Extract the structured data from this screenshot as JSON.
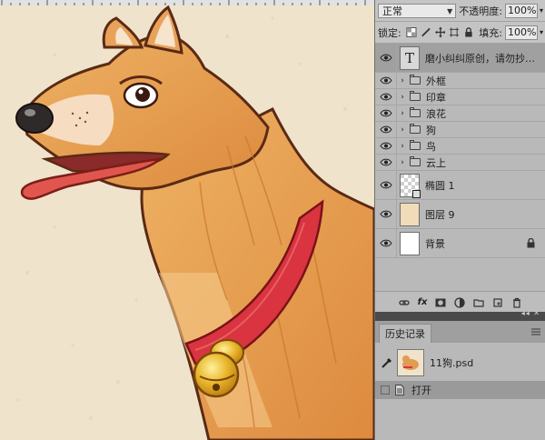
{
  "layers_panel": {
    "blend_mode": "正常",
    "opacity_label": "不透明度:",
    "opacity_value": "100%",
    "lock_label": "锁定:",
    "fill_label": "填充:",
    "fill_value": "100%",
    "layers": [
      {
        "kind": "text",
        "name": "磨小纠纠原创，请勿抄…",
        "selected": true
      },
      {
        "kind": "group",
        "name": "外框"
      },
      {
        "kind": "group",
        "name": "印章"
      },
      {
        "kind": "group",
        "name": "浪花"
      },
      {
        "kind": "group",
        "name": "狗"
      },
      {
        "kind": "group",
        "name": "鸟"
      },
      {
        "kind": "group",
        "name": "云上"
      },
      {
        "kind": "shape",
        "name": "椭圆 1"
      },
      {
        "kind": "pixel",
        "name": "图层 9"
      },
      {
        "kind": "background",
        "name": "背景",
        "locked": true
      }
    ],
    "footer_icons": [
      "link-icon",
      "fx-icon",
      "mask-icon",
      "adjustment-icon",
      "group-icon",
      "new-layer-icon",
      "trash-icon"
    ]
  },
  "history_panel": {
    "tab_label": "历史记录",
    "snapshot_name": "11狗.psd",
    "steps": [
      "打开"
    ]
  },
  "colors": {
    "canvas_bg": "#efe3cc",
    "fur": "#e6a057",
    "collar": "#d9343f",
    "bell": "#e9b22c",
    "panel_bg": "#b9b9b9"
  }
}
